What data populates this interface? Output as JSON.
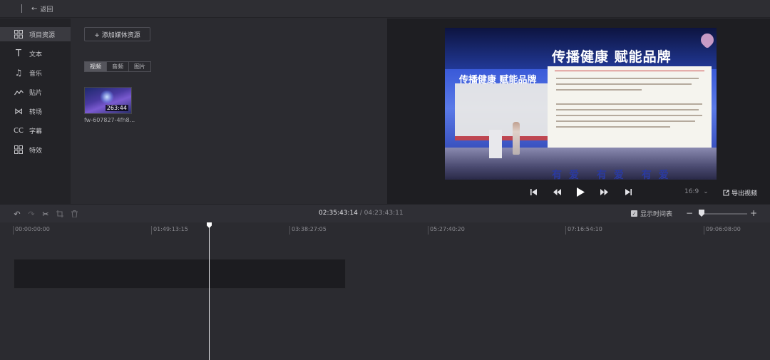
{
  "topbar": {
    "back_label": "返回",
    "back_icon": "arrow-left-icon"
  },
  "sidebar": {
    "items": [
      {
        "label": "项目资源",
        "icon": "grid-icon"
      },
      {
        "label": "文本",
        "icon": "text-icon"
      },
      {
        "label": "音乐",
        "icon": "music-note-icon"
      },
      {
        "label": "贴片",
        "icon": "sticker-icon"
      },
      {
        "label": "转场",
        "icon": "transition-icon"
      },
      {
        "label": "字幕",
        "icon": "caption-icon"
      },
      {
        "label": "特效",
        "icon": "effects-icon"
      }
    ],
    "active_index": 0
  },
  "media": {
    "add_label": "+ 添加媒体资源",
    "tabs": [
      "视频",
      "音频",
      "图片"
    ],
    "active_tab": 0,
    "items": [
      {
        "name": "fw-607827-4fh8...",
        "duration": "263:44"
      }
    ]
  },
  "preview": {
    "video_title": "传播健康  赋能品牌",
    "video_subtitle": "传播健康  赋能品牌",
    "video_footer": "有爱 有爱 有爱",
    "aspect_ratio": "16:9",
    "export_label": "导出视频"
  },
  "timeline": {
    "current_time": "02:35:43:14",
    "separator": " / ",
    "total_time": "04:23:43:11",
    "show_timestamp_label": "显示时间表",
    "show_timestamp_checked": true,
    "zoom_level": 0,
    "ruler_ticks": [
      "00:00:00:00",
      "01:49:13:15",
      "03:38:27:05",
      "05:27:40:20",
      "07:16:54:10",
      "09:06:08:00"
    ],
    "playhead_time": "02:35:43:14",
    "clip": {
      "start_time": "00:00:00:00",
      "end_time": "04:23:43:11"
    }
  },
  "colors": {
    "background": "#2b2b30",
    "sidebar": "#232327",
    "preview_bg": "#1e1e22",
    "accent_text": "#e4e4e8"
  }
}
